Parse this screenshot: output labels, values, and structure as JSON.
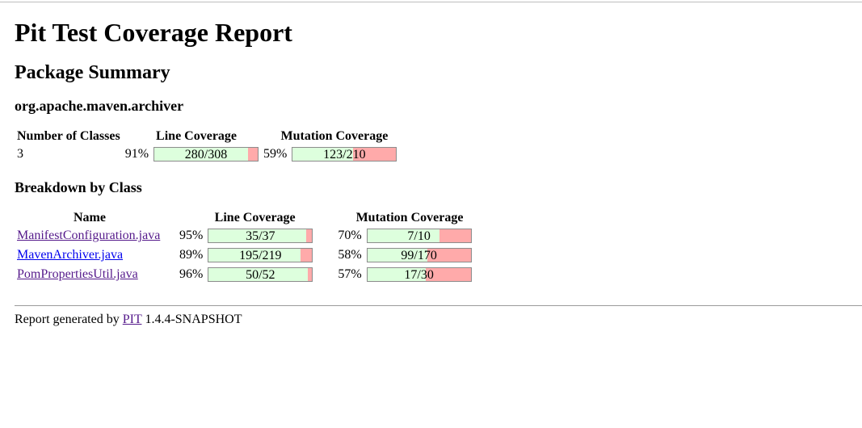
{
  "title": "Pit Test Coverage Report",
  "package_summary": {
    "heading": "Package Summary",
    "package_name": "org.apache.maven.archiver",
    "headers": {
      "classes": "Number of Classes",
      "line": "Line Coverage",
      "mutation": "Mutation Coverage"
    },
    "classes": "3",
    "line_percent": "91%",
    "line_ratio": "280/308",
    "line_fraction": 0.909,
    "mutation_percent": "59%",
    "mutation_ratio": "123/210",
    "mutation_fraction": 0.586
  },
  "breakdown": {
    "heading": "Breakdown by Class",
    "headers": {
      "name": "Name",
      "line": "Line Coverage",
      "mutation": "Mutation Coverage"
    },
    "rows": [
      {
        "name": "ManifestConfiguration.java",
        "line_percent": "95%",
        "line_ratio": "35/37",
        "line_fraction": 0.946,
        "mutation_percent": "70%",
        "mutation_ratio": "7/10",
        "mutation_fraction": 0.7
      },
      {
        "name": "MavenArchiver.java",
        "line_percent": "89%",
        "line_ratio": "195/219",
        "line_fraction": 0.89,
        "mutation_percent": "58%",
        "mutation_ratio": "99/170",
        "mutation_fraction": 0.582
      },
      {
        "name": "PomPropertiesUtil.java",
        "line_percent": "96%",
        "line_ratio": "50/52",
        "line_fraction": 0.962,
        "mutation_percent": "57%",
        "mutation_ratio": "17/30",
        "mutation_fraction": 0.567
      }
    ]
  },
  "footer": {
    "prefix": "Report generated by",
    "link": "PIT",
    "version": "1.4.4-SNAPSHOT"
  },
  "colors": {
    "covered": "#ddffdd",
    "uncovered": "#ffaaaa",
    "visited_link": "#551a8b",
    "link": "#0000ee"
  }
}
